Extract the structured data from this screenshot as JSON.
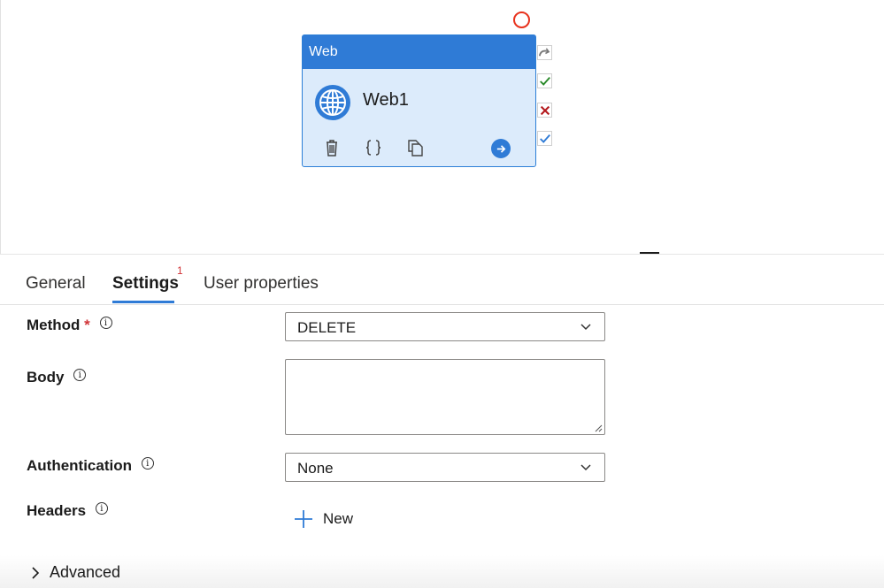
{
  "activity": {
    "type_label": "Web",
    "name": "Web1",
    "icons": [
      "globe-icon",
      "delete-icon",
      "code-icon",
      "copy-icon",
      "go-arrow-icon"
    ]
  },
  "dependency_icons": [
    "skip-arrow-icon",
    "success-check-icon",
    "failure-x-icon",
    "completion-check-icon"
  ],
  "tabs": [
    {
      "label": "General"
    },
    {
      "label": "Settings",
      "badge": "1",
      "active": true
    },
    {
      "label": "User properties"
    }
  ],
  "form": {
    "method": {
      "label": "Method",
      "required_mark": "*",
      "value": "DELETE"
    },
    "body": {
      "label": "Body",
      "value": ""
    },
    "authentication": {
      "label": "Authentication",
      "value": "None"
    },
    "headers": {
      "label": "Headers",
      "new_label": "New"
    },
    "advanced_label": "Advanced"
  },
  "info_glyph": "i",
  "colors": {
    "accent": "#2f7bd6",
    "activity_bg": "#dcebfb",
    "required": "#d13438",
    "status_circle": "#e8321d",
    "success": "#2a8a2a",
    "failure": "#b3181c"
  }
}
